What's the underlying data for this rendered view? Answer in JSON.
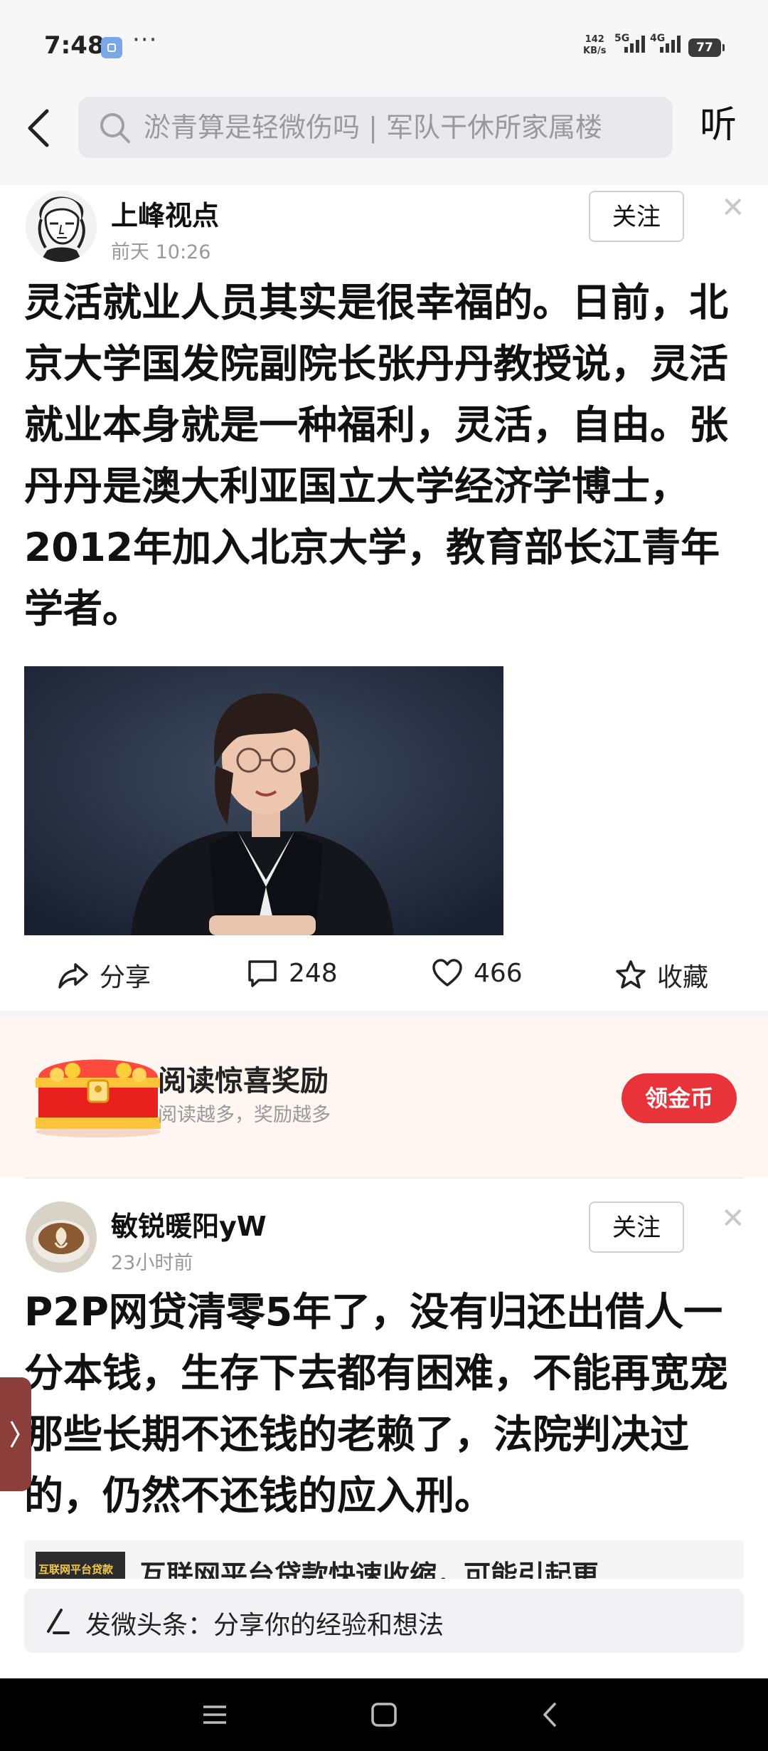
{
  "status_bar": {
    "time": "7:48",
    "more": "···",
    "net_speed_value": "142",
    "net_speed_unit": "KB/s",
    "signal1_label": "5G",
    "signal2_label": "4G",
    "battery": "77"
  },
  "search": {
    "placeholder": "淤青算是轻微伤吗 | 军队干休所家属楼",
    "listen_label": "听"
  },
  "post1": {
    "author": "上峰视点",
    "time": "前天   10:26",
    "follow_label": "关注",
    "text": "灵活就业人员其实是很幸福的。日前，北京大学国发院副院长张丹丹教授说，灵活就业本身就是一种福利，灵活，自由。张丹丹是澳大利亚国立大学经济学博士，2012年加入北京大学，教育部长江青年学者。",
    "actions": {
      "share": "分享",
      "comments": "248",
      "likes": "466",
      "favorite": "收藏"
    }
  },
  "promo": {
    "title": "阅读惊喜奖励",
    "subtitle": "阅读越多，奖励越多",
    "button": "领金币"
  },
  "post2": {
    "author": "敏锐暖阳yW",
    "time": "23小时前",
    "follow_label": "关注",
    "text": "P2P网贷清零5年了，没有归还出借人一分本钱，生存下去都有困难，不能再宽宠那些长期不还钱的老赖了，法院判决过的，仍然不还钱的应入刑。",
    "link_thumb_label": "互联网平台贷款",
    "link_title": "互联网平台贷款快速收缩，可能引起更"
  },
  "compose": {
    "placeholder": "发微头条：分享你的经验和想法"
  },
  "colors": {
    "accent_red": "#e8333a",
    "background_gray": "#f7f7f7"
  }
}
